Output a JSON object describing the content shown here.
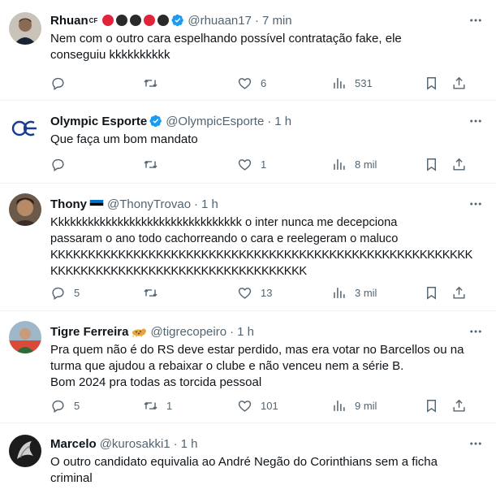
{
  "tweets": [
    {
      "name": "Rhuan",
      "name_suffix": "CF",
      "handle": "@rhuaan17",
      "time": "7 min",
      "verified": true,
      "lines": [
        "Nem com o outro cara espelhando possível contratação fake, ele",
        "conseguiu kkkkkkkkkk"
      ],
      "replies": "",
      "retweets": "",
      "likes": "6",
      "views": "531"
    },
    {
      "name": "Olympic Esporte",
      "handle": "@OlympicEsporte",
      "time": "1 h",
      "verified": true,
      "lines": [
        "Que faça um bom mandato"
      ],
      "replies": "",
      "retweets": "",
      "likes": "1",
      "views": "8 mil"
    },
    {
      "name": "Thony",
      "handle": "@ThonyTrovao",
      "time": "1 h",
      "verified": false,
      "lines": [
        "Kkkkkkkkkkkkkkkkkkkkkkkkkkkkkkkk o inter nunca me decepciona",
        "passaram o ano todo cachorreando o cara e reelegeram o maluco",
        "KKKKKKKKKKKKKKKKKKKKKKKKKKKKKKKKKKKKKKKKKKKKKKKKKKKKKKKK",
        "KKKKKKKKKKKKKKKKKKKKKKKKKKKKKKKKKK"
      ],
      "replies": "5",
      "retweets": "",
      "likes": "13",
      "views": "3 mil"
    },
    {
      "name": "Tigre Ferreira",
      "handle": "@tigrecopeiro",
      "time": "1 h",
      "verified": false,
      "lines": [
        "Pra quem não é do RS deve estar perdido, mas era votar no Barcellos ou na",
        "turma que ajudou a rebaixar o clube e não venceu nem a série B.",
        "Bom 2024 pra todas as torcida pessoal"
      ],
      "replies": "5",
      "retweets": "1",
      "likes": "101",
      "views": "9 mil"
    },
    {
      "name": "Marcelo",
      "handle": "@kurosakki1",
      "time": "1 h",
      "verified": false,
      "lines": [
        "O outro candidato equivalia ao André Negão do Corinthians sem a ficha",
        "criminal"
      ]
    }
  ],
  "colors": {
    "text": "#0f1419",
    "muted": "#536471",
    "verified": "#1d9bf0",
    "divider": "#eff3f4"
  },
  "icons": [
    "reply-icon",
    "retweet-icon",
    "like-icon",
    "views-icon",
    "bookmark-icon",
    "share-icon",
    "more-icon",
    "verified-badge-icon"
  ]
}
